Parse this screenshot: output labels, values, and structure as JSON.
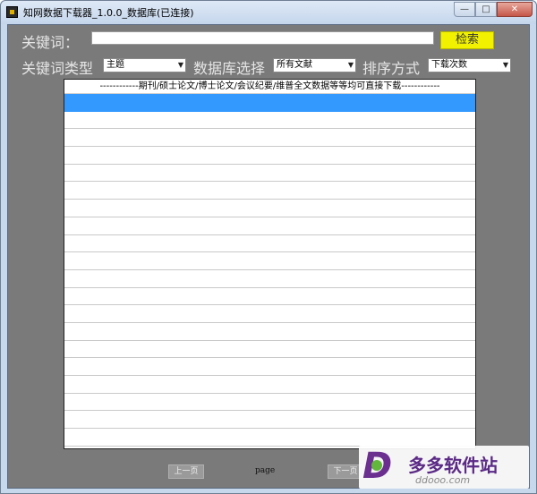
{
  "window": {
    "title": "知网数据下载器_1.0.0_数据库(已连接)",
    "controls": {
      "minimize": "—",
      "maximize": "□",
      "close": "✕"
    }
  },
  "search": {
    "keyword_label": "关键词：",
    "keyword_value": "",
    "search_button": "检索"
  },
  "filters": {
    "keyword_type_label": "关键词类型",
    "keyword_type_value": "主题",
    "database_label": "数据库选择",
    "database_value": "所有文献",
    "sort_label": "排序方式",
    "sort_value": "下载次数"
  },
  "results": {
    "header": "------------期刊/硕士论文/博士论文/会议纪要/维普全文数据等等均可直接下载------------",
    "rows": 20,
    "selected_row": 0
  },
  "pager": {
    "prev_label": "上一页",
    "page_label": "page",
    "next_label": "下一页"
  },
  "watermark": {
    "name": "多多软件站",
    "url": "ddooo.com"
  },
  "colors": {
    "client_bg": "#7a7a7a",
    "search_button": "#f2f200",
    "selection": "#3399ff"
  }
}
